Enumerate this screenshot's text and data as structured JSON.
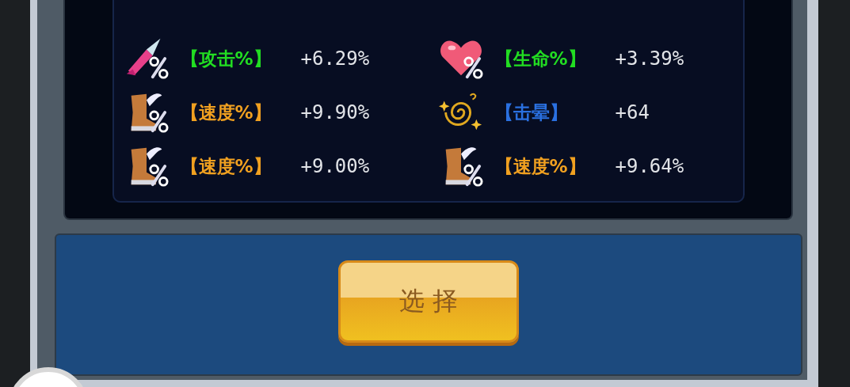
{
  "stats": [
    {
      "kind": "sword",
      "label": "【攻击%】",
      "color": "#22dd22",
      "value": "+6.29%"
    },
    {
      "kind": "heart",
      "label": "【生命%】",
      "color": "#22dd22",
      "value": "+3.39%"
    },
    {
      "kind": "boot",
      "label": "【速度%】",
      "color": "#f0a020",
      "value": "+9.90%"
    },
    {
      "kind": "swirl",
      "label": "【击晕】",
      "color": "#2a70e0",
      "value": "+64"
    },
    {
      "kind": "boot",
      "label": "【速度%】",
      "color": "#f0a020",
      "value": "+9.00%"
    },
    {
      "kind": "boot",
      "label": "【速度%】",
      "color": "#f0a020",
      "value": "+9.64%"
    }
  ],
  "button": {
    "label": "选 择"
  }
}
